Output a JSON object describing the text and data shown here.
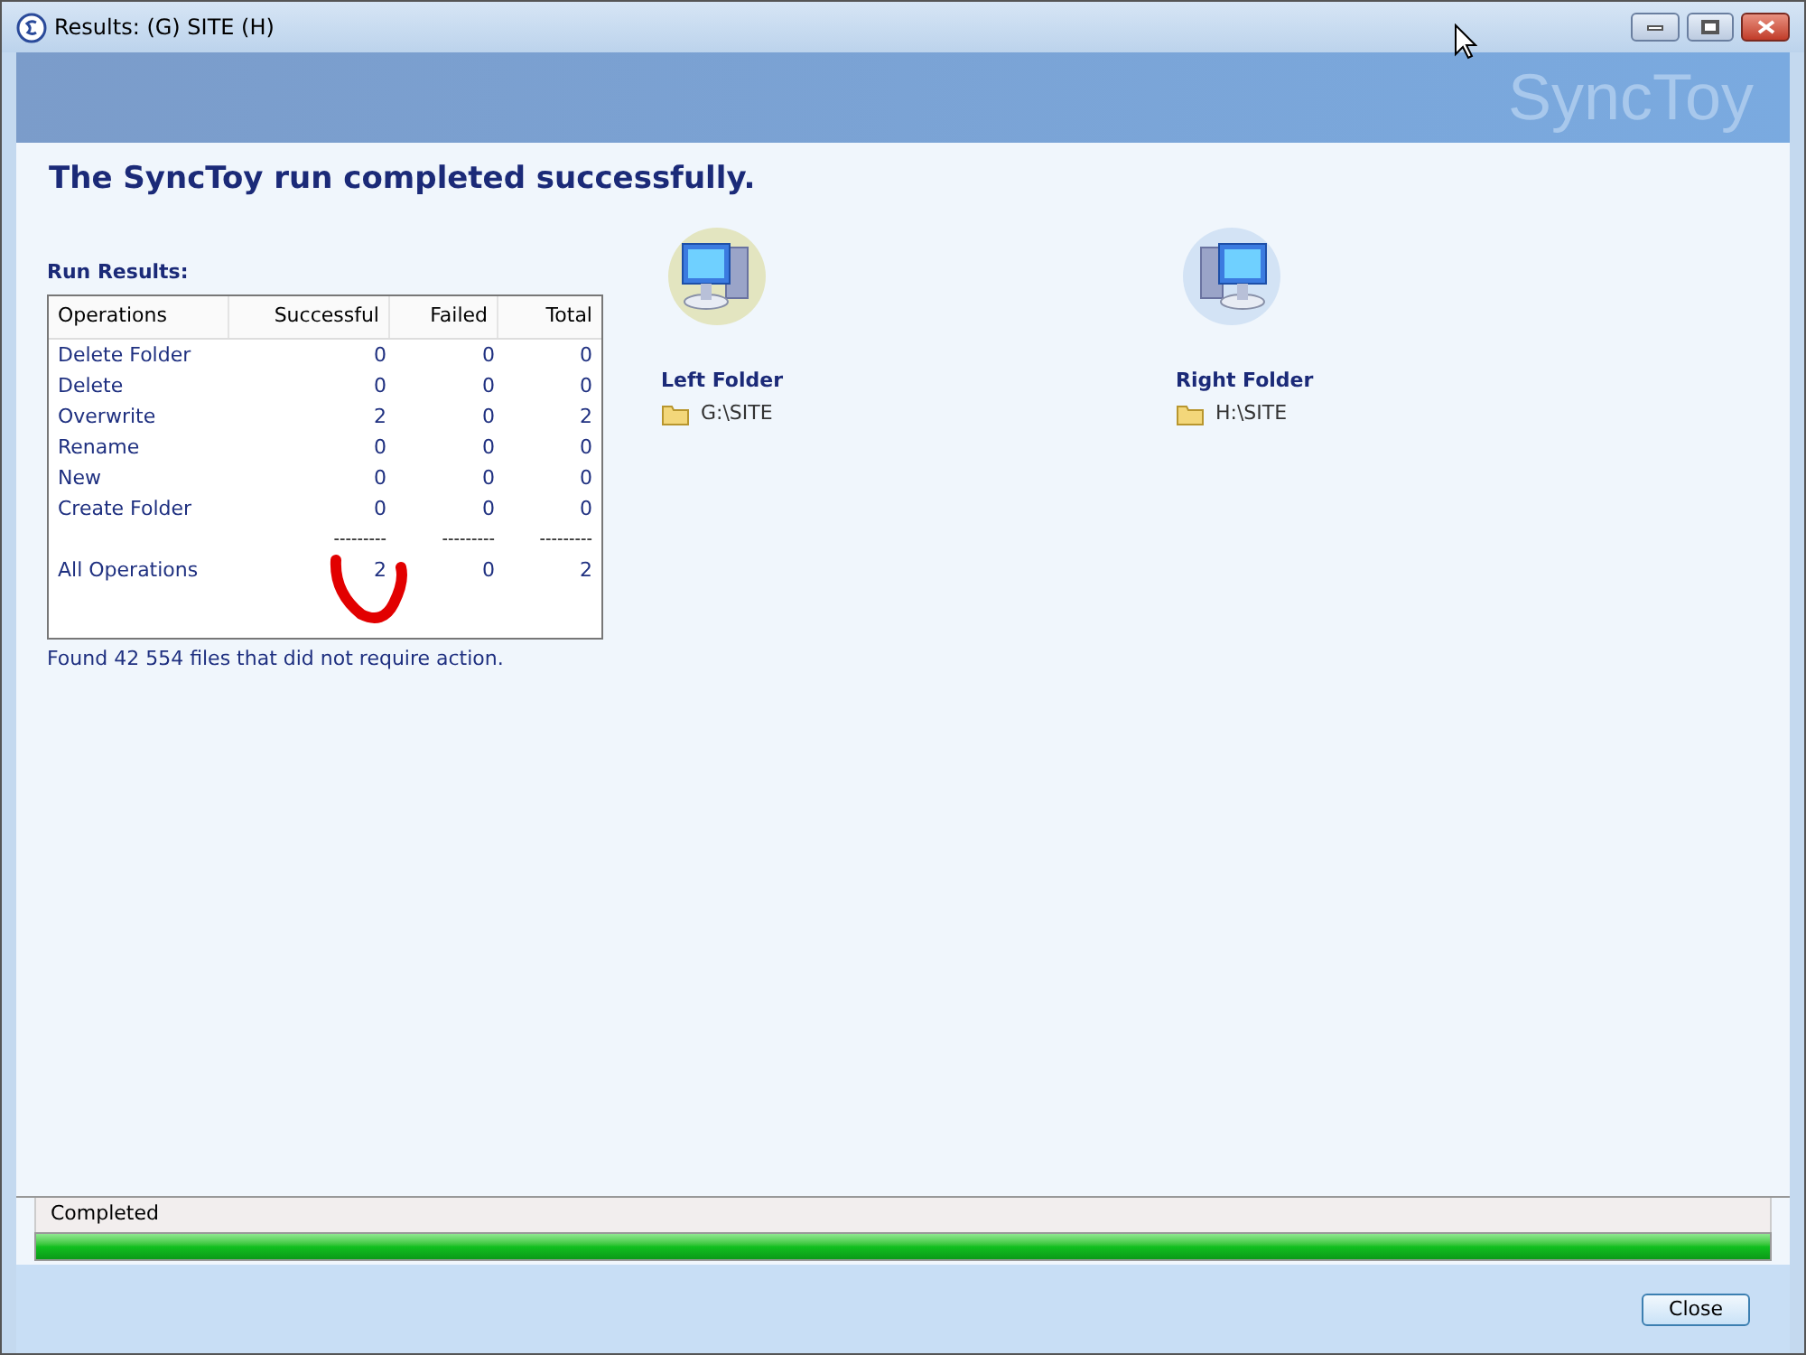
{
  "window": {
    "title": "Results: (G) SITE (H)"
  },
  "banner": {
    "logo": "SyncToy"
  },
  "headline": "The SyncToy run completed successfully.",
  "run_results": {
    "title": "Run Results:",
    "columns": [
      "Operations",
      "Successful",
      "Failed",
      "Total"
    ],
    "rows": [
      {
        "cells": [
          "Delete Folder",
          "0",
          "0",
          "0"
        ]
      },
      {
        "cells": [
          "Delete",
          "0",
          "0",
          "0"
        ]
      },
      {
        "cells": [
          "Overwrite",
          "2",
          "0",
          "2"
        ]
      },
      {
        "cells": [
          "Rename",
          "0",
          "0",
          "0"
        ]
      },
      {
        "cells": [
          "New",
          "0",
          "0",
          "0"
        ]
      },
      {
        "cells": [
          "Create Folder",
          "0",
          "0",
          "0"
        ]
      }
    ],
    "separators": [
      "---------",
      "---------",
      "---------"
    ],
    "total": {
      "cells": [
        "All Operations",
        "2",
        "0",
        "2"
      ]
    },
    "note": "Found 42 554 files that did not require action."
  },
  "folders": [
    {
      "label": "Left Folder",
      "path": "G:\\SITE",
      "kind": "left"
    },
    {
      "label": "Right Folder",
      "path": "H:\\SITE",
      "kind": "right"
    }
  ],
  "status": {
    "text": "Completed",
    "level": 1
  },
  "buttons": [
    "Close"
  ]
}
